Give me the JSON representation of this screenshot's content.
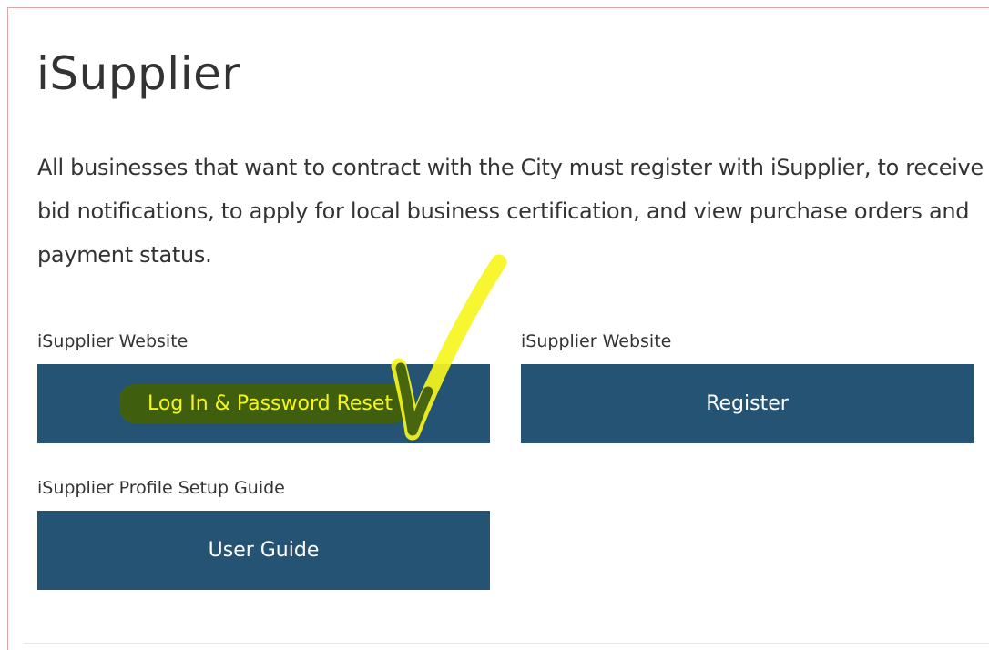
{
  "page": {
    "title": "iSupplier",
    "description": "All businesses that want to contract with the City must register with iSupplier, to receive bid notifications, to apply for local business certification, and view purchase orders and payment status."
  },
  "links": [
    {
      "label": "iSupplier Website",
      "button": "Log In & Password Reset"
    },
    {
      "label": "iSupplier Website",
      "button": "Register"
    },
    {
      "label": "iSupplier Profile Setup Guide",
      "button": "User Guide"
    }
  ],
  "colors": {
    "button_bg": "#255374",
    "button_text": "#ffffff",
    "annotation_yellow": "#f6f51e",
    "annotation_green": "#3f5f0e"
  },
  "annotations": {
    "checkmark": "yellow-green-checkmark-icon"
  }
}
